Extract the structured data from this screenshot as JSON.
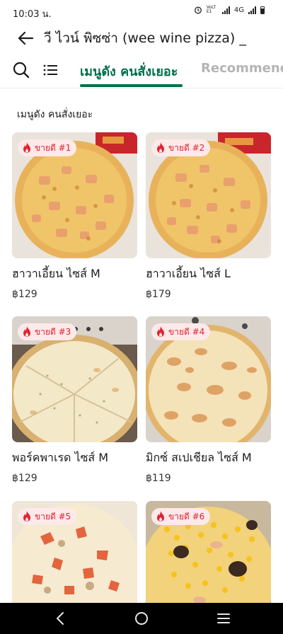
{
  "status_bar": {
    "time": "10:03 น.",
    "volte_label": "VoLTE1",
    "network_label": "4G"
  },
  "header": {
    "title": "วี ไวน์ พิซซ่า (wee wine pizza) _"
  },
  "tabs": [
    {
      "label": "เมนูดัง คนสั่งเยอะ",
      "active": true
    },
    {
      "label": "Recommended",
      "active": false
    }
  ],
  "section": {
    "title": "เมนูดัง คนสั่งเยอะ"
  },
  "products": [
    {
      "badge": "ขายดี #1",
      "name": "ฮาวาเอี้ยน ไซส์ M",
      "price": "฿129",
      "image": "hawaiian-pizza"
    },
    {
      "badge": "ขายดี #2",
      "name": "ฮาวาเอี้ยน ไซส์ L",
      "price": "฿179",
      "image": "hawaiian-pizza"
    },
    {
      "badge": "ขายดี #3",
      "name": "พอร์คพาเรด ไซส์ M",
      "price": "฿129",
      "image": "cheese-pizza"
    },
    {
      "badge": "ขายดี #4",
      "name": "มิกซ์ สเปเชียล ไซส์ M",
      "price": "฿119",
      "image": "special-pizza"
    },
    {
      "badge": "ขายดี #5",
      "name": "",
      "price": "",
      "image": "tomato-pizza"
    },
    {
      "badge": "ขายดี #6",
      "name": "",
      "price": "",
      "image": "corn-olive-pizza"
    }
  ],
  "colors": {
    "accent": "#00704a",
    "badge_bg": "#fde9ea",
    "badge_text": "#e0232e"
  },
  "icons": [
    "back-arrow-icon",
    "search-icon",
    "list-icon",
    "fire-icon",
    "nav-back-icon",
    "nav-home-icon",
    "nav-recents-icon"
  ]
}
